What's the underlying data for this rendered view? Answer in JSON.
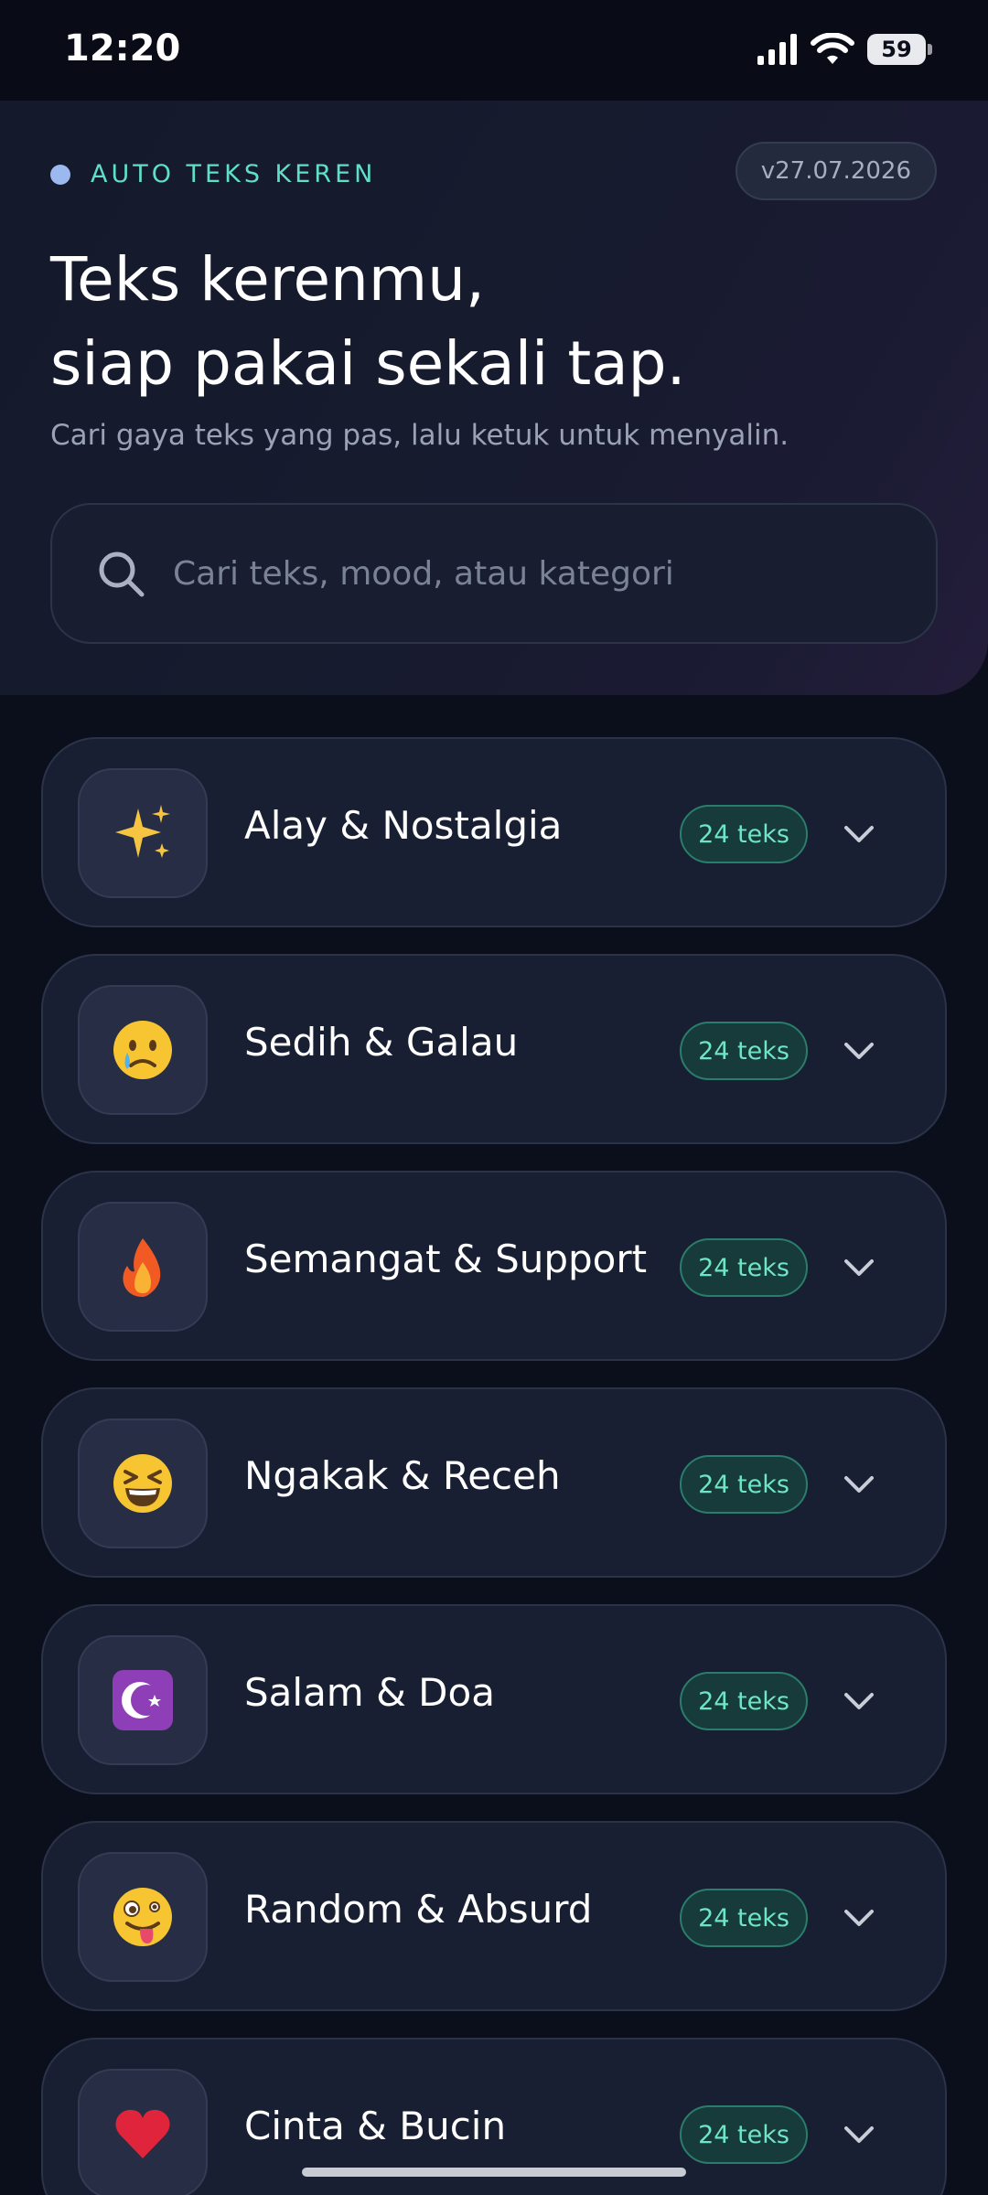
{
  "status_bar": {
    "time": "12:20",
    "battery": "59"
  },
  "header": {
    "brand": "AUTO TEKS KEREN",
    "version": "v27.07.2026",
    "title_line1": "Teks kerenmu,",
    "title_line2": "siap pakai sekali tap.",
    "subtitle": "Cari gaya teks yang pas, lalu ketuk untuk menyalin."
  },
  "search": {
    "placeholder": "Cari teks, mood, atau kategori",
    "icon": "search-icon"
  },
  "categories": [
    {
      "label": "Alay & Nostalgia",
      "count": "24 teks",
      "icon": "sparkles-icon"
    },
    {
      "label": "Sedih & Galau",
      "count": "24 teks",
      "icon": "crying-face-icon"
    },
    {
      "label": "Semangat & Support",
      "count": "24 teks",
      "icon": "fire-icon"
    },
    {
      "label": "Ngakak & Receh",
      "count": "24 teks",
      "icon": "laughing-face-icon"
    },
    {
      "label": "Salam & Doa",
      "count": "24 teks",
      "icon": "star-crescent-icon"
    },
    {
      "label": "Random & Absurd",
      "count": "24 teks",
      "icon": "zany-face-icon"
    },
    {
      "label": "Cinta & Bucin",
      "count": "24 teks",
      "icon": "heart-icon"
    }
  ],
  "colors": {
    "background": "#0b0f1c",
    "accent": "#5fe0c6",
    "card": "#181f33",
    "badge_text": "#6ee6c6"
  }
}
